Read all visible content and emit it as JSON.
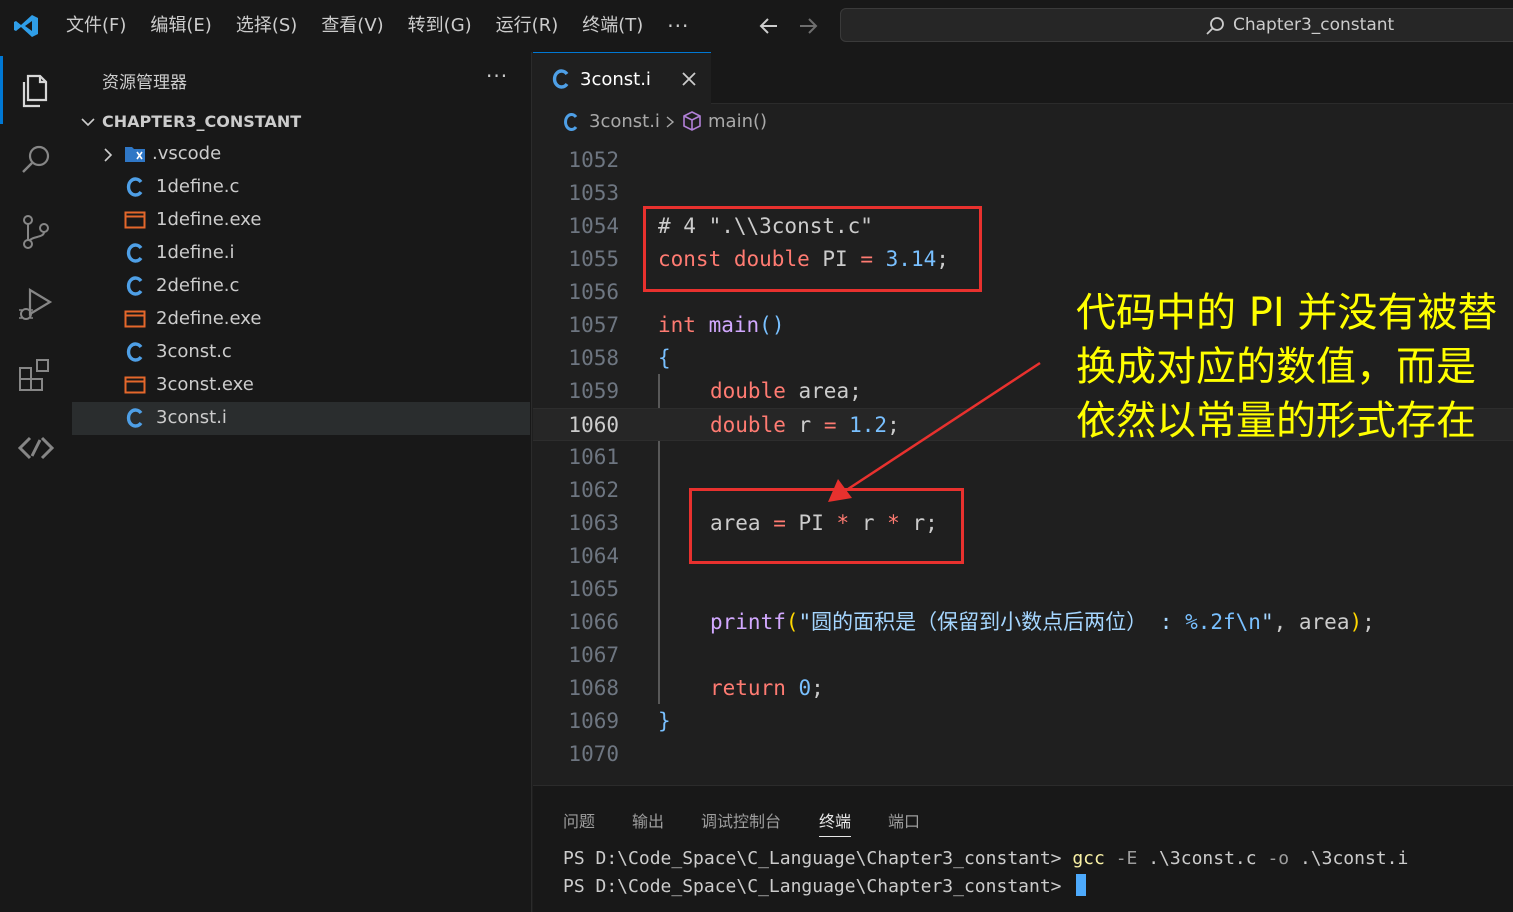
{
  "titlebar": {
    "menu": [
      "文件(F)",
      "编辑(E)",
      "选择(S)",
      "查看(V)",
      "转到(G)",
      "运行(R)",
      "终端(T)"
    ],
    "more": "···",
    "search_text": "Chapter3_constant"
  },
  "activitybar": {
    "icons": [
      "explorer-icon",
      "search-icon",
      "source-control-icon",
      "run-debug-icon",
      "extensions-icon",
      "remote-icon"
    ]
  },
  "sidebar": {
    "title": "资源管理器",
    "more": "···",
    "folder": "CHAPTER3_CONSTANT",
    "items": [
      {
        "label": ".vscode",
        "type": "folder"
      },
      {
        "label": "1define.c",
        "type": "c"
      },
      {
        "label": "1define.exe",
        "type": "exe"
      },
      {
        "label": "1define.i",
        "type": "c"
      },
      {
        "label": "2define.c",
        "type": "c"
      },
      {
        "label": "2define.exe",
        "type": "exe"
      },
      {
        "label": "3const.c",
        "type": "c"
      },
      {
        "label": "3const.exe",
        "type": "exe"
      },
      {
        "label": "3const.i",
        "type": "c",
        "selected": true
      }
    ]
  },
  "editor": {
    "tab_label": "3const.i",
    "breadcrumb": {
      "file": "3const.i",
      "symbol": "main()"
    },
    "line_numbers": [
      "1052",
      "1053",
      "1054",
      "1055",
      "1056",
      "1057",
      "1058",
      "1059",
      "1060",
      "1061",
      "1062",
      "1063",
      "1064",
      "1065",
      "1066",
      "1067",
      "1068",
      "1069",
      "1070"
    ],
    "current_line": "1060",
    "code": {
      "l1054": "# 4 \".\\\\3const.c\"",
      "l1055_kw1": "const",
      "l1055_kw2": "double",
      "l1055_id": "PI",
      "l1055_op": "=",
      "l1055_num": "3.14",
      "l1055_end": ";",
      "l1057_type": "int",
      "l1057_fn": "main",
      "l1057_paren": "()",
      "l1058": "{",
      "l1059_type": "double",
      "l1059_rest": "area;",
      "l1060_type": "double",
      "l1060_id": "r",
      "l1060_op": "=",
      "l1060_num": "1.2",
      "l1060_end": ";",
      "l1063_id1": "area",
      "l1063_op1": "=",
      "l1063_id2": "PI",
      "l1063_op2": "*",
      "l1063_id3": "r",
      "l1063_op3": "*",
      "l1063_id4": "r;",
      "l1066_fn": "printf",
      "l1066_open": "(",
      "l1066_str": "\"圆的面积是（保留到小数点后两位） : ",
      "l1066_fmt": "%.2f\\n",
      "l1066_strend": "\"",
      "l1066_rest": ", area",
      "l1066_close": ")",
      "l1066_end": ";",
      "l1068_kw": "return",
      "l1068_num": "0",
      "l1068_end": ";",
      "l1069": "}"
    }
  },
  "annotation": {
    "lines": [
      "代码中的 PI 并没有被替",
      "换成对应的数值，而是",
      "依然以常量的形式存在"
    ],
    "color": "#ffff00",
    "box_color": "#e8312e"
  },
  "panel": {
    "tabs": [
      "问题",
      "输出",
      "调试控制台",
      "终端",
      "端口"
    ],
    "active_tab": "终端",
    "terminal": {
      "line1_prompt": "PS D:\\Code_Space\\C_Language\\Chapter3_constant> ",
      "line1_cmd": "gcc",
      "line1_flag1": " -E ",
      "line1_arg1": ".\\3const.c ",
      "line1_flag2": "-o ",
      "line1_arg2": ".\\3const.i",
      "line2_prompt": "PS D:\\Code_Space\\C_Language\\Chapter3_constant> "
    }
  }
}
